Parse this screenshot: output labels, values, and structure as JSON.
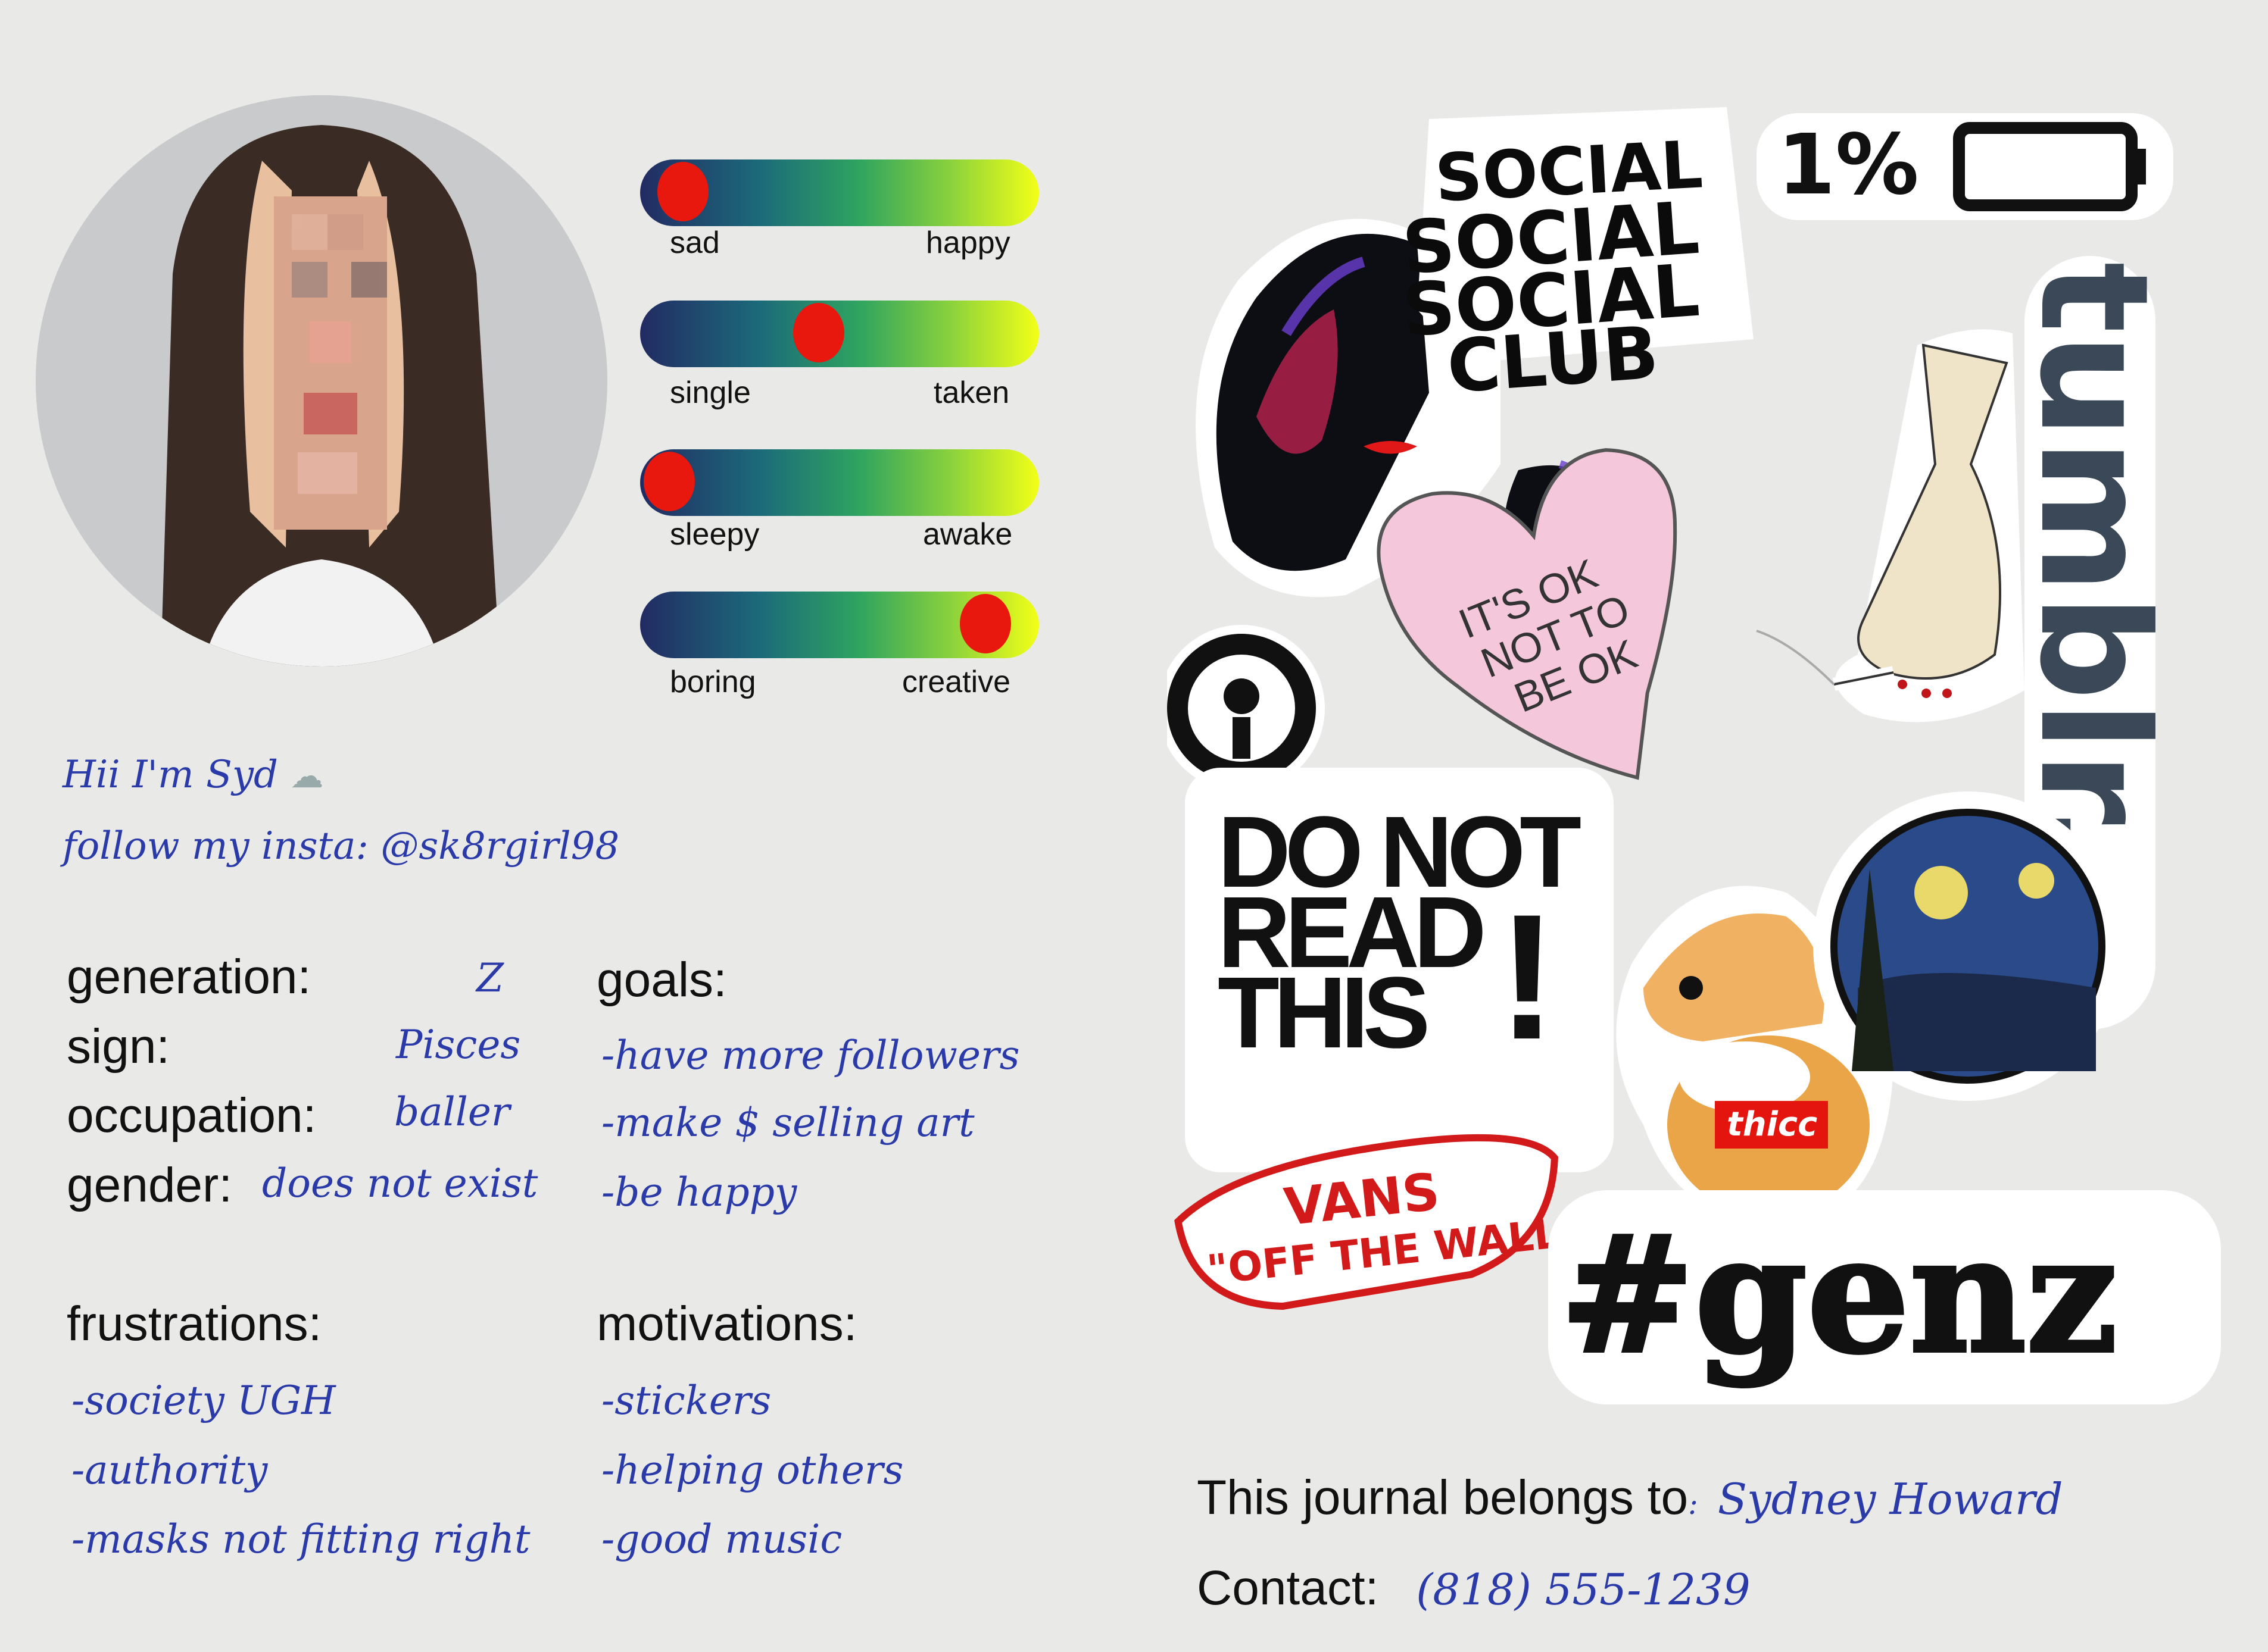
{
  "sliders": [
    {
      "left": "sad",
      "right": "happy",
      "value": 0.05
    },
    {
      "left": "single",
      "right": "taken",
      "value": 0.44
    },
    {
      "left": "sleepy",
      "right": "awake",
      "value": 0.01
    },
    {
      "left": "boring",
      "right": "creative",
      "value": 0.92
    }
  ],
  "intro": {
    "line1": "Hii I'm Syd",
    "line2": "follow my insta: @sk8rgirl98"
  },
  "profile": {
    "generation_label": "generation:",
    "generation_value": "Z",
    "sign_label": "sign:",
    "sign_value": "Pisces",
    "occupation_label": "occupation:",
    "occupation_value": "baller",
    "gender_label": "gender:",
    "gender_value": "does not exist"
  },
  "goals": {
    "heading": "goals:",
    "items": [
      "-have more followers",
      "-make $ selling art",
      "-be happy"
    ]
  },
  "frustrations": {
    "heading": "frustrations:",
    "items": [
      "-society UGH",
      "-authority",
      "-masks not fitting right"
    ]
  },
  "motivations": {
    "heading": "motivations:",
    "items": [
      "-stickers",
      "-helping others",
      "-good music"
    ]
  },
  "stickers": {
    "social1": "SOCIAL",
    "social2": "SOCIAL",
    "social3": "SOCIAL",
    "club": "CLUB",
    "battery": "1%",
    "tumblr": "tumblr.",
    "heart1": "IT'S OK",
    "heart2": "NOT TO",
    "heart3": "BE OK",
    "donot1": "DO NOT",
    "donot2": "READ",
    "donot3": "THIS",
    "excl": "!",
    "thicc": "thicc",
    "vans1": "VANS",
    "vans2": "\"OFF THE WALL\"",
    "genz": "#genz"
  },
  "footer": {
    "owner_label": "This journal belongs to",
    "owner_sep": ":",
    "owner_value": "Sydney Howard",
    "contact_label": "Contact:",
    "contact_value": "(818) 555-1239"
  }
}
